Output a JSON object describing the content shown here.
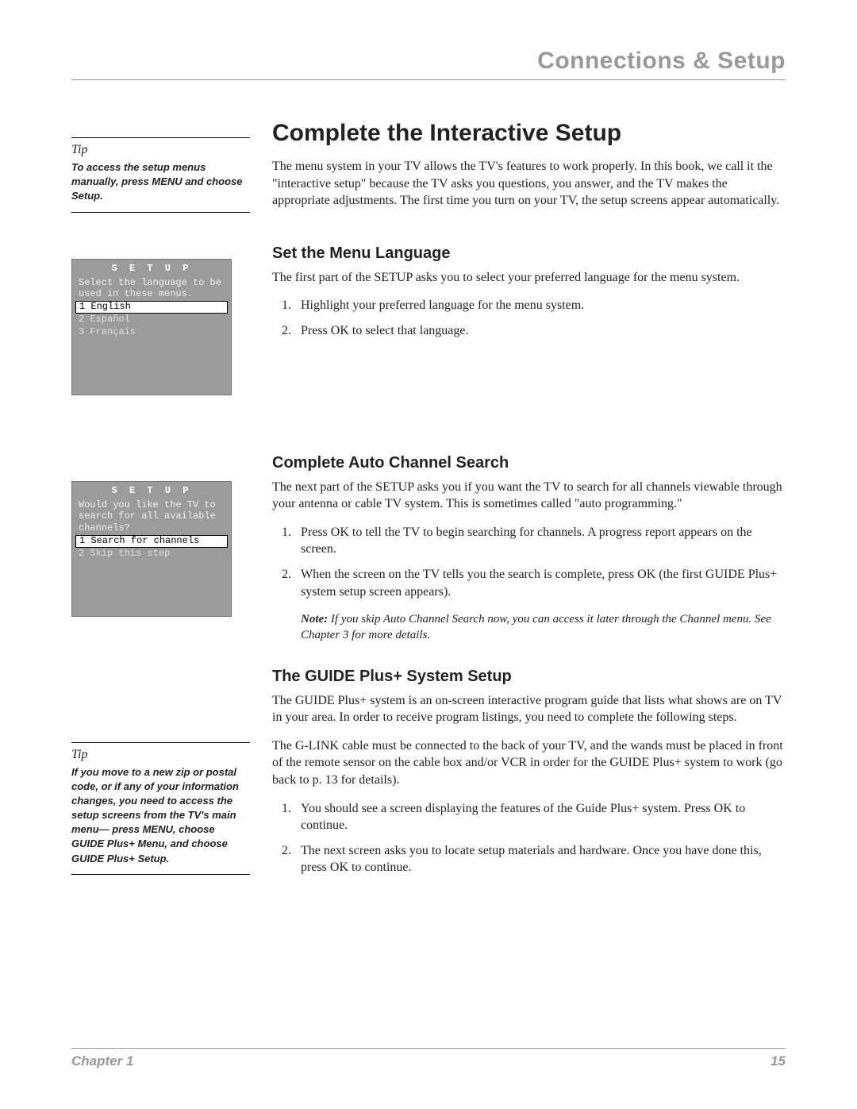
{
  "running_head": "Connections & Setup",
  "main": {
    "heading": "Complete the Interactive Setup",
    "intro": "The menu system in your TV allows the TV's features to work properly. In this book, we call it the \"interactive setup\" because the TV asks you questions, you answer, and the TV makes the appropriate adjustments. The first time you turn on your TV, the setup screens appear automatically."
  },
  "tip1": {
    "label": "Tip",
    "text": "To access the setup menus manually, press MENU and choose Setup."
  },
  "screen1": {
    "title": "S E T U P",
    "prompt": "Select the language to be used in these menus.",
    "item1": "1 English",
    "item2": "2 Español",
    "item3": "3 Français"
  },
  "section1": {
    "heading": "Set the Menu Language",
    "para": "The first part of the SETUP asks you to select your preferred language for the menu system.",
    "step1": "Highlight your preferred language for the menu system.",
    "step2": "Press OK to select that language."
  },
  "screen2": {
    "title": "S E T U P",
    "prompt": "Would you like the TV to search for all available channels?",
    "item1": "1 Search for channels",
    "item2": "2 Skip this step"
  },
  "section2": {
    "heading": "Complete Auto Channel Search",
    "para": "The next part of the SETUP asks you if you want the TV to search for all channels viewable through your antenna or cable TV system. This is sometimes called \"auto programming.\"",
    "step1": "Press OK to tell the TV to begin searching for channels. A progress report appears on the screen.",
    "step2": "When the screen on the TV tells you the search is complete, press OK (the first GUIDE Plus+ system setup screen appears).",
    "note_label": "Note:",
    "note_text": "If you skip Auto Channel Search now, you can access it later through the Channel menu. See Chapter 3 for more details."
  },
  "tip2": {
    "label": "Tip",
    "text": "If you move to a new zip or postal code, or if any of your information changes, you need to access the setup screens from the TV's main menu— press MENU, choose GUIDE Plus+ Menu, and choose GUIDE Plus+ Setup."
  },
  "section3": {
    "heading": "The GUIDE Plus+ System Setup",
    "para1": "The GUIDE Plus+ system is an on-screen interactive program guide that lists what shows are on TV in your area. In order to receive program listings, you need to complete the following steps.",
    "para2": "The G-LINK cable must be connected to the back of your TV, and the wands must be placed in front of the remote sensor on the cable box and/or VCR in order for the GUIDE Plus+ system to work (go back to p. 13 for details).",
    "step1": "You should see a screen displaying the features of the Guide Plus+ system. Press OK to continue.",
    "step2": "The next screen asks you to locate setup materials and hardware. Once you have done this, press OK to continue."
  },
  "footer": {
    "chapter": "Chapter 1",
    "page": "15"
  }
}
